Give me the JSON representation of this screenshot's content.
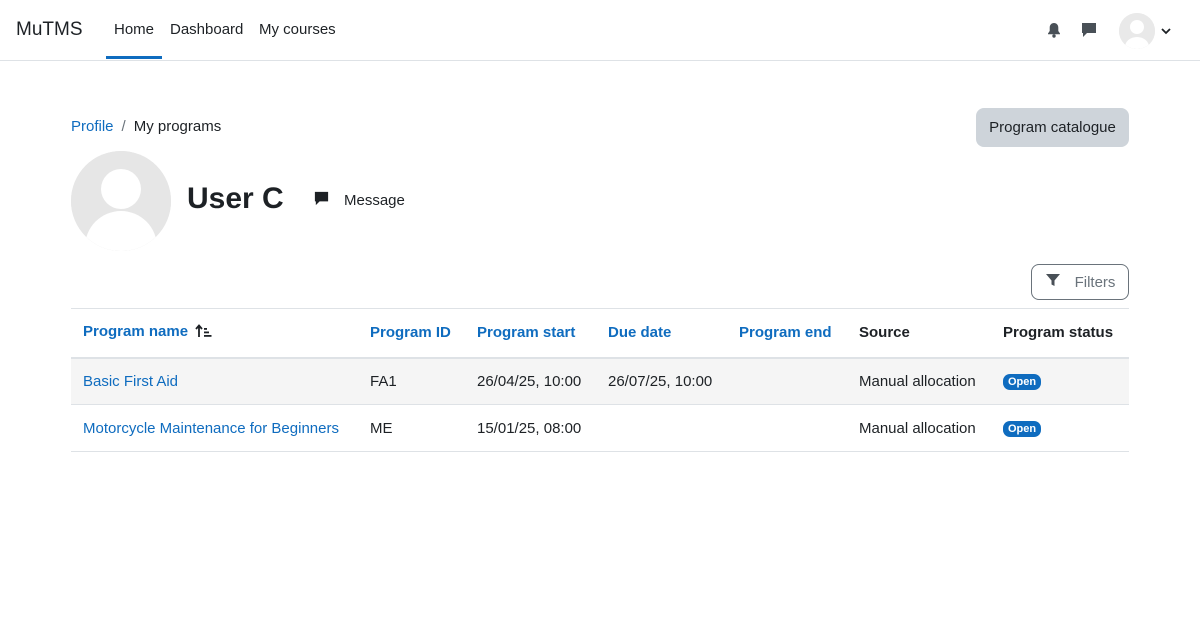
{
  "navbar": {
    "brand": "MuTMS",
    "items": [
      {
        "label": "Home",
        "active": true
      },
      {
        "label": "Dashboard",
        "active": false
      },
      {
        "label": "My courses",
        "active": false
      }
    ],
    "icons": [
      "bell-icon",
      "chat-icon",
      "user-avatar",
      "chevron-down-icon"
    ]
  },
  "breadcrumb": {
    "items": [
      "Profile",
      "My programs"
    ],
    "separator": "/"
  },
  "catalogue_button": "Program catalogue",
  "profile": {
    "name": "User C",
    "message_label": "Message"
  },
  "filters_button": "Filters",
  "table": {
    "columns": [
      "Program name",
      "Program ID",
      "Program start",
      "Due date",
      "Program end",
      "Source",
      "Program status"
    ],
    "sorted_column": "Program name",
    "rows": [
      {
        "name": "Basic First Aid",
        "id": "FA1",
        "start": "26/04/25, 10:00",
        "due": "26/07/25, 10:00",
        "end": "",
        "source": "Manual allocation",
        "status": "Open"
      },
      {
        "name": "Motorcycle Maintenance for Beginners",
        "id": "ME",
        "start": "15/01/25, 08:00",
        "due": "",
        "end": "",
        "source": "Manual allocation",
        "status": "Open"
      }
    ]
  },
  "colors": {
    "link": "#0f6cbf",
    "badge": "#0f6cbf",
    "secondary_button": "#ced4da",
    "text": "#1d2125"
  }
}
